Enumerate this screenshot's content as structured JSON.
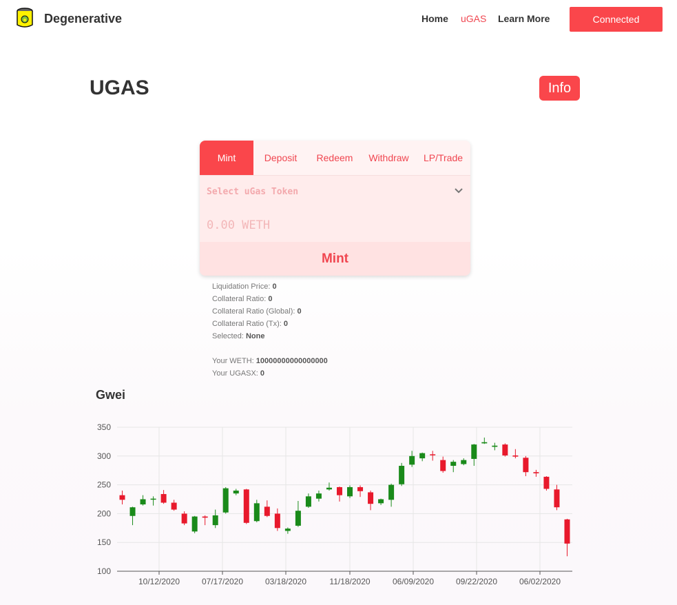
{
  "header": {
    "brand": "Degenerative",
    "nav": [
      "Home",
      "uGAS",
      "Learn More"
    ],
    "active_nav": "uGAS",
    "connect_label": "Connected"
  },
  "page": {
    "title": "UGAS",
    "info_label": "Info"
  },
  "card": {
    "tabs": [
      "Mint",
      "Deposit",
      "Redeem",
      "Withdraw",
      "LP/Trade"
    ],
    "active_tab": "Mint",
    "select_placeholder": "Select uGas Token",
    "amount_placeholder": "0.00 WETH",
    "action_label": "Mint"
  },
  "stats": [
    {
      "label": "Liquidation Price:",
      "value": "0"
    },
    {
      "label": "Collateral Ratio:",
      "value": "0"
    },
    {
      "label": "Collateral Ratio (Global):",
      "value": "0"
    },
    {
      "label": "Collateral Ratio (Tx):",
      "value": "0"
    },
    {
      "label": "Selected:",
      "value": "None"
    }
  ],
  "balances": [
    {
      "label": "Your WETH:",
      "value": "10000000000000000"
    },
    {
      "label": "Your UGASX:",
      "value": "0"
    }
  ],
  "colors": {
    "accent": "#fa464b",
    "up": "#1a8a1a",
    "down": "#e8192c"
  },
  "chart_data": {
    "type": "candlestick",
    "title": "Gwei",
    "ylim": [
      100,
      350
    ],
    "yticks": [
      100,
      150,
      200,
      250,
      300,
      350
    ],
    "xtick_labels": [
      "10/12/2020",
      "07/17/2020",
      "03/18/2020",
      "11/18/2020",
      "06/09/2020",
      "09/22/2020",
      "06/02/2020"
    ],
    "candles": [
      {
        "o": 232,
        "c": 224,
        "h": 240,
        "l": 216
      },
      {
        "o": 196,
        "c": 211,
        "h": 212,
        "l": 180
      },
      {
        "o": 216,
        "c": 225,
        "h": 232,
        "l": 214
      },
      {
        "o": 225,
        "c": 226,
        "h": 230,
        "l": 214
      },
      {
        "o": 234,
        "c": 219,
        "h": 241,
        "l": 217
      },
      {
        "o": 219,
        "c": 207,
        "h": 224,
        "l": 205
      },
      {
        "o": 200,
        "c": 183,
        "h": 204,
        "l": 180
      },
      {
        "o": 169,
        "c": 195,
        "h": 196,
        "l": 166
      },
      {
        "o": 195,
        "c": 193,
        "h": 197,
        "l": 180
      },
      {
        "o": 180,
        "c": 197,
        "h": 207,
        "l": 175
      },
      {
        "o": 202,
        "c": 244,
        "h": 246,
        "l": 200
      },
      {
        "o": 235,
        "c": 240,
        "h": 243,
        "l": 232
      },
      {
        "o": 242,
        "c": 184,
        "h": 243,
        "l": 182
      },
      {
        "o": 187,
        "c": 218,
        "h": 224,
        "l": 185
      },
      {
        "o": 212,
        "c": 196,
        "h": 223,
        "l": 194
      },
      {
        "o": 200,
        "c": 175,
        "h": 209,
        "l": 170
      },
      {
        "o": 170,
        "c": 174,
        "h": 176,
        "l": 165
      },
      {
        "o": 179,
        "c": 205,
        "h": 222,
        "l": 177
      },
      {
        "o": 212,
        "c": 230,
        "h": 235,
        "l": 210
      },
      {
        "o": 226,
        "c": 235,
        "h": 240,
        "l": 221
      },
      {
        "o": 242,
        "c": 245,
        "h": 254,
        "l": 240
      },
      {
        "o": 246,
        "c": 232,
        "h": 247,
        "l": 221
      },
      {
        "o": 230,
        "c": 246,
        "h": 249,
        "l": 227
      },
      {
        "o": 246,
        "c": 239,
        "h": 249,
        "l": 229
      },
      {
        "o": 237,
        "c": 217,
        "h": 240,
        "l": 206
      },
      {
        "o": 218,
        "c": 225,
        "h": 226,
        "l": 215
      },
      {
        "o": 224,
        "c": 250,
        "h": 252,
        "l": 212
      },
      {
        "o": 251,
        "c": 283,
        "h": 288,
        "l": 248
      },
      {
        "o": 285,
        "c": 300,
        "h": 309,
        "l": 281
      },
      {
        "o": 296,
        "c": 305,
        "h": 306,
        "l": 291
      },
      {
        "o": 303,
        "c": 302,
        "h": 309,
        "l": 292
      },
      {
        "o": 293,
        "c": 274,
        "h": 299,
        "l": 271
      },
      {
        "o": 283,
        "c": 290,
        "h": 293,
        "l": 272
      },
      {
        "o": 286,
        "c": 293,
        "h": 296,
        "l": 284
      },
      {
        "o": 295,
        "c": 320,
        "h": 321,
        "l": 283
      },
      {
        "o": 322,
        "c": 324,
        "h": 332,
        "l": 321
      },
      {
        "o": 316,
        "c": 318,
        "h": 323,
        "l": 310
      },
      {
        "o": 320,
        "c": 301,
        "h": 322,
        "l": 299
      },
      {
        "o": 301,
        "c": 299,
        "h": 312,
        "l": 296
      },
      {
        "o": 297,
        "c": 272,
        "h": 300,
        "l": 265
      },
      {
        "o": 272,
        "c": 270,
        "h": 276,
        "l": 264
      },
      {
        "o": 264,
        "c": 243,
        "h": 265,
        "l": 240
      },
      {
        "o": 242,
        "c": 211,
        "h": 250,
        "l": 206
      },
      {
        "o": 190,
        "c": 148,
        "h": 191,
        "l": 126
      }
    ]
  }
}
